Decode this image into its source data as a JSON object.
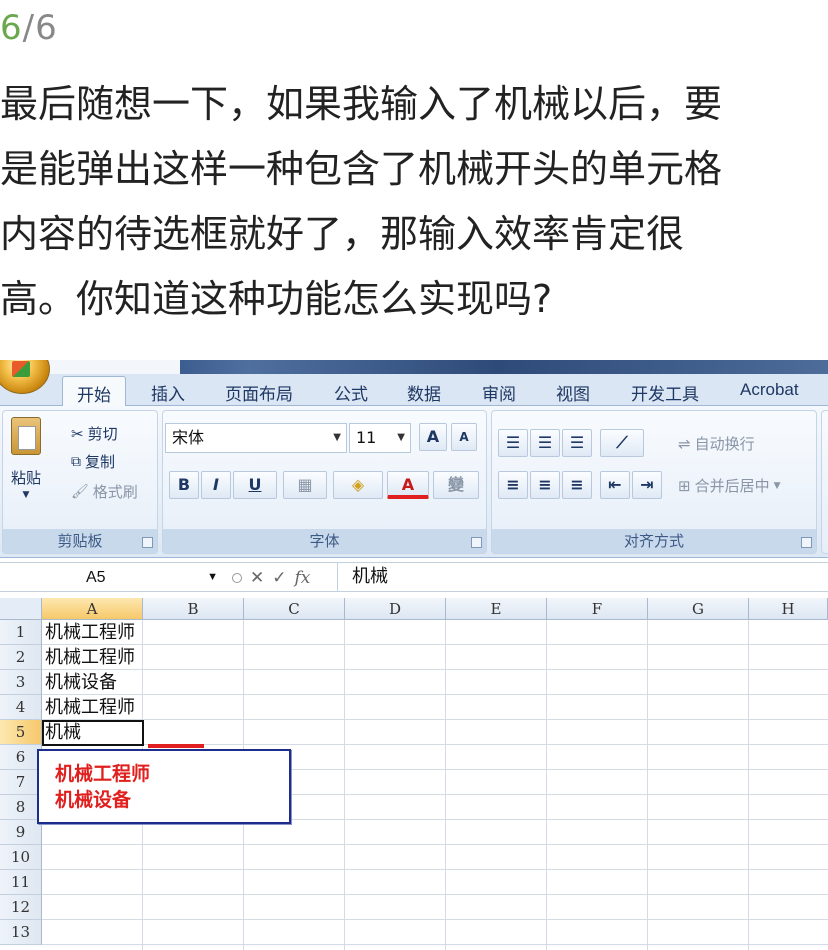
{
  "article": {
    "counter_current": "6",
    "counter_total": "/6",
    "question_lines": [
      "最后随想一下，如果我输入了机械以后，要",
      "是能弹出这样一种包含了机械开头的单元格",
      "内容的待选框就好了，那输入效率肯定很",
      "高。你知道这种功能怎么实现吗?"
    ]
  },
  "excel": {
    "tabs": [
      "开始",
      "插入",
      "页面布局",
      "公式",
      "数据",
      "审阅",
      "视图",
      "开发工具",
      "Acrobat"
    ],
    "active_tab": "开始",
    "clipboard": {
      "title": "剪贴板",
      "paste": "粘贴",
      "cut": "剪切",
      "copy": "复制",
      "format_painter": "格式刷"
    },
    "font": {
      "title": "字体",
      "font_name": "宋体",
      "font_size": "11",
      "grow": "A",
      "shrink": "A",
      "bold": "B",
      "italic": "I",
      "underline": "U",
      "font_color": "A",
      "phonetic": "變"
    },
    "alignment": {
      "title": "对齐方式",
      "wrap_text": "自动换行",
      "merge_center": "合并后居中"
    },
    "formula_bar": {
      "name_box": "A5",
      "cancel": "✕",
      "enter": "✓",
      "fx": "fx",
      "content": "机械"
    },
    "columns": [
      "A",
      "B",
      "C",
      "D",
      "E",
      "F",
      "G",
      "H"
    ],
    "rows": [
      "1",
      "2",
      "3",
      "4",
      "5",
      "6",
      "7",
      "8",
      "9",
      "10",
      "11",
      "12",
      "13"
    ],
    "column_a_values": [
      "机械工程师",
      "机械工程师",
      "机械设备",
      "机械工程师",
      "机械"
    ],
    "autocomplete": [
      "机械工程师",
      "机械设备"
    ],
    "colors": {
      "dropdown_text": "#e0201e",
      "dropdown_border": "#1c2d8c",
      "ribbon_blue": "#dbe6f4"
    }
  }
}
